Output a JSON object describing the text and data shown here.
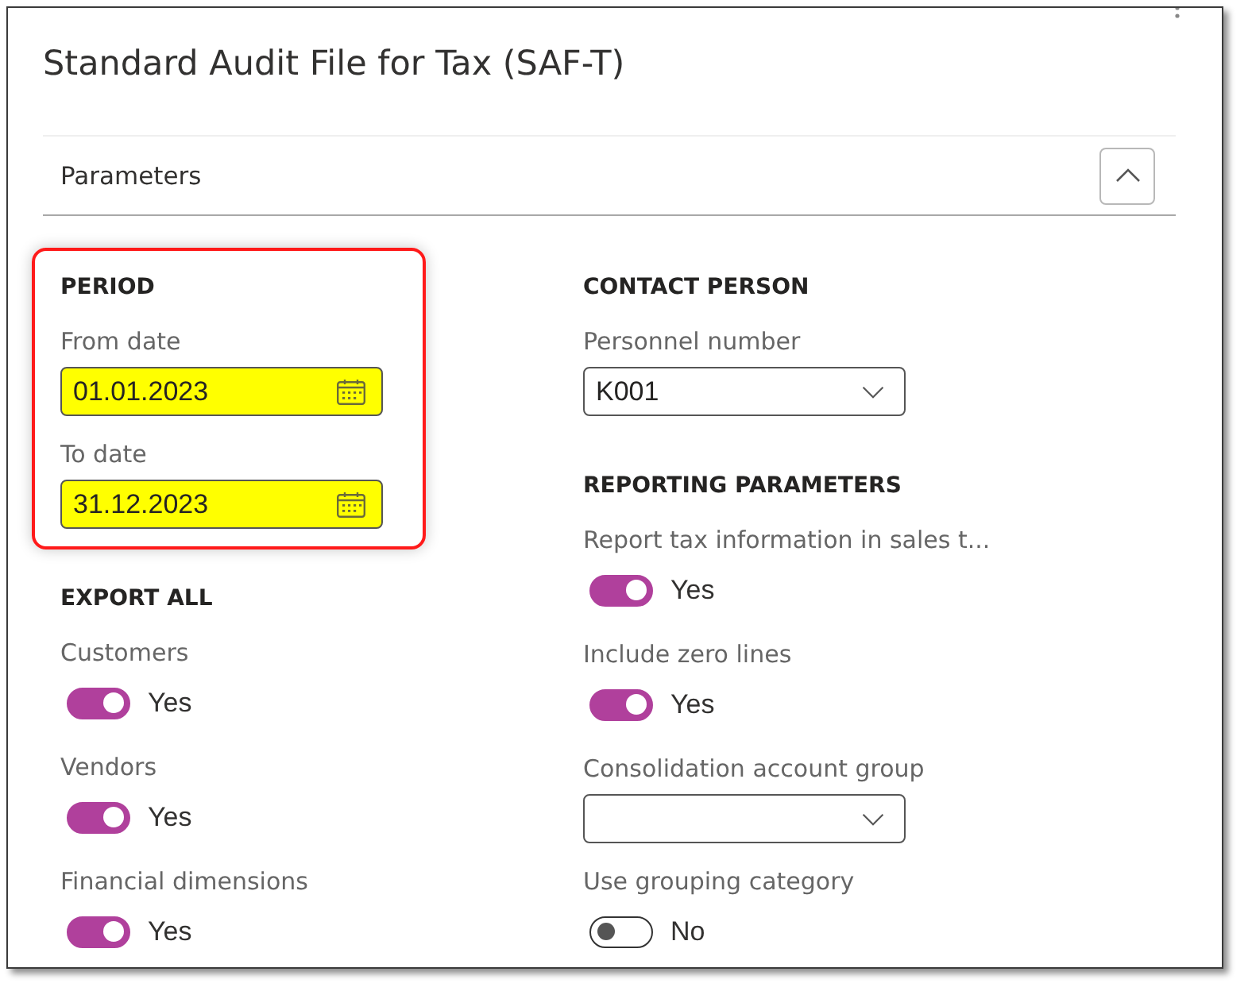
{
  "window": {
    "title": "Standard Audit File for Tax (SAF-T)"
  },
  "section": {
    "title": "Parameters",
    "expanded": true
  },
  "columns": [
    {
      "groups": [
        {
          "heading": "PERIOD",
          "highlighted": true,
          "fields": [
            {
              "kind": "date",
              "label": "From date",
              "value": "01.01.2023",
              "highlighted": true
            },
            {
              "kind": "date",
              "label": "To date",
              "value": "31.12.2023",
              "highlighted": true
            }
          ]
        },
        {
          "heading": "EXPORT ALL",
          "highlighted": false,
          "fields": [
            {
              "kind": "toggle",
              "label": "Customers",
              "on": true,
              "value": "Yes"
            },
            {
              "kind": "toggle",
              "label": "Vendors",
              "on": true,
              "value": "Yes"
            },
            {
              "kind": "toggle",
              "label": "Financial dimensions",
              "on": true,
              "value": "Yes"
            }
          ]
        }
      ]
    },
    {
      "groups": [
        {
          "heading": "CONTACT PERSON",
          "highlighted": false,
          "fields": [
            {
              "kind": "dropdown",
              "label": "Personnel number",
              "value": "K001"
            }
          ]
        },
        {
          "heading": "REPORTING PARAMETERS",
          "highlighted": false,
          "fields": [
            {
              "kind": "toggle",
              "label": "Report tax information in sales t...",
              "on": true,
              "value": "Yes"
            },
            {
              "kind": "toggle",
              "label": "Include zero lines",
              "on": true,
              "value": "Yes"
            },
            {
              "kind": "dropdown",
              "label": "Consolidation account group"
            },
            {
              "kind": "toggle",
              "label": "Use grouping category",
              "on": false,
              "value": "No"
            }
          ]
        }
      ]
    }
  ]
}
